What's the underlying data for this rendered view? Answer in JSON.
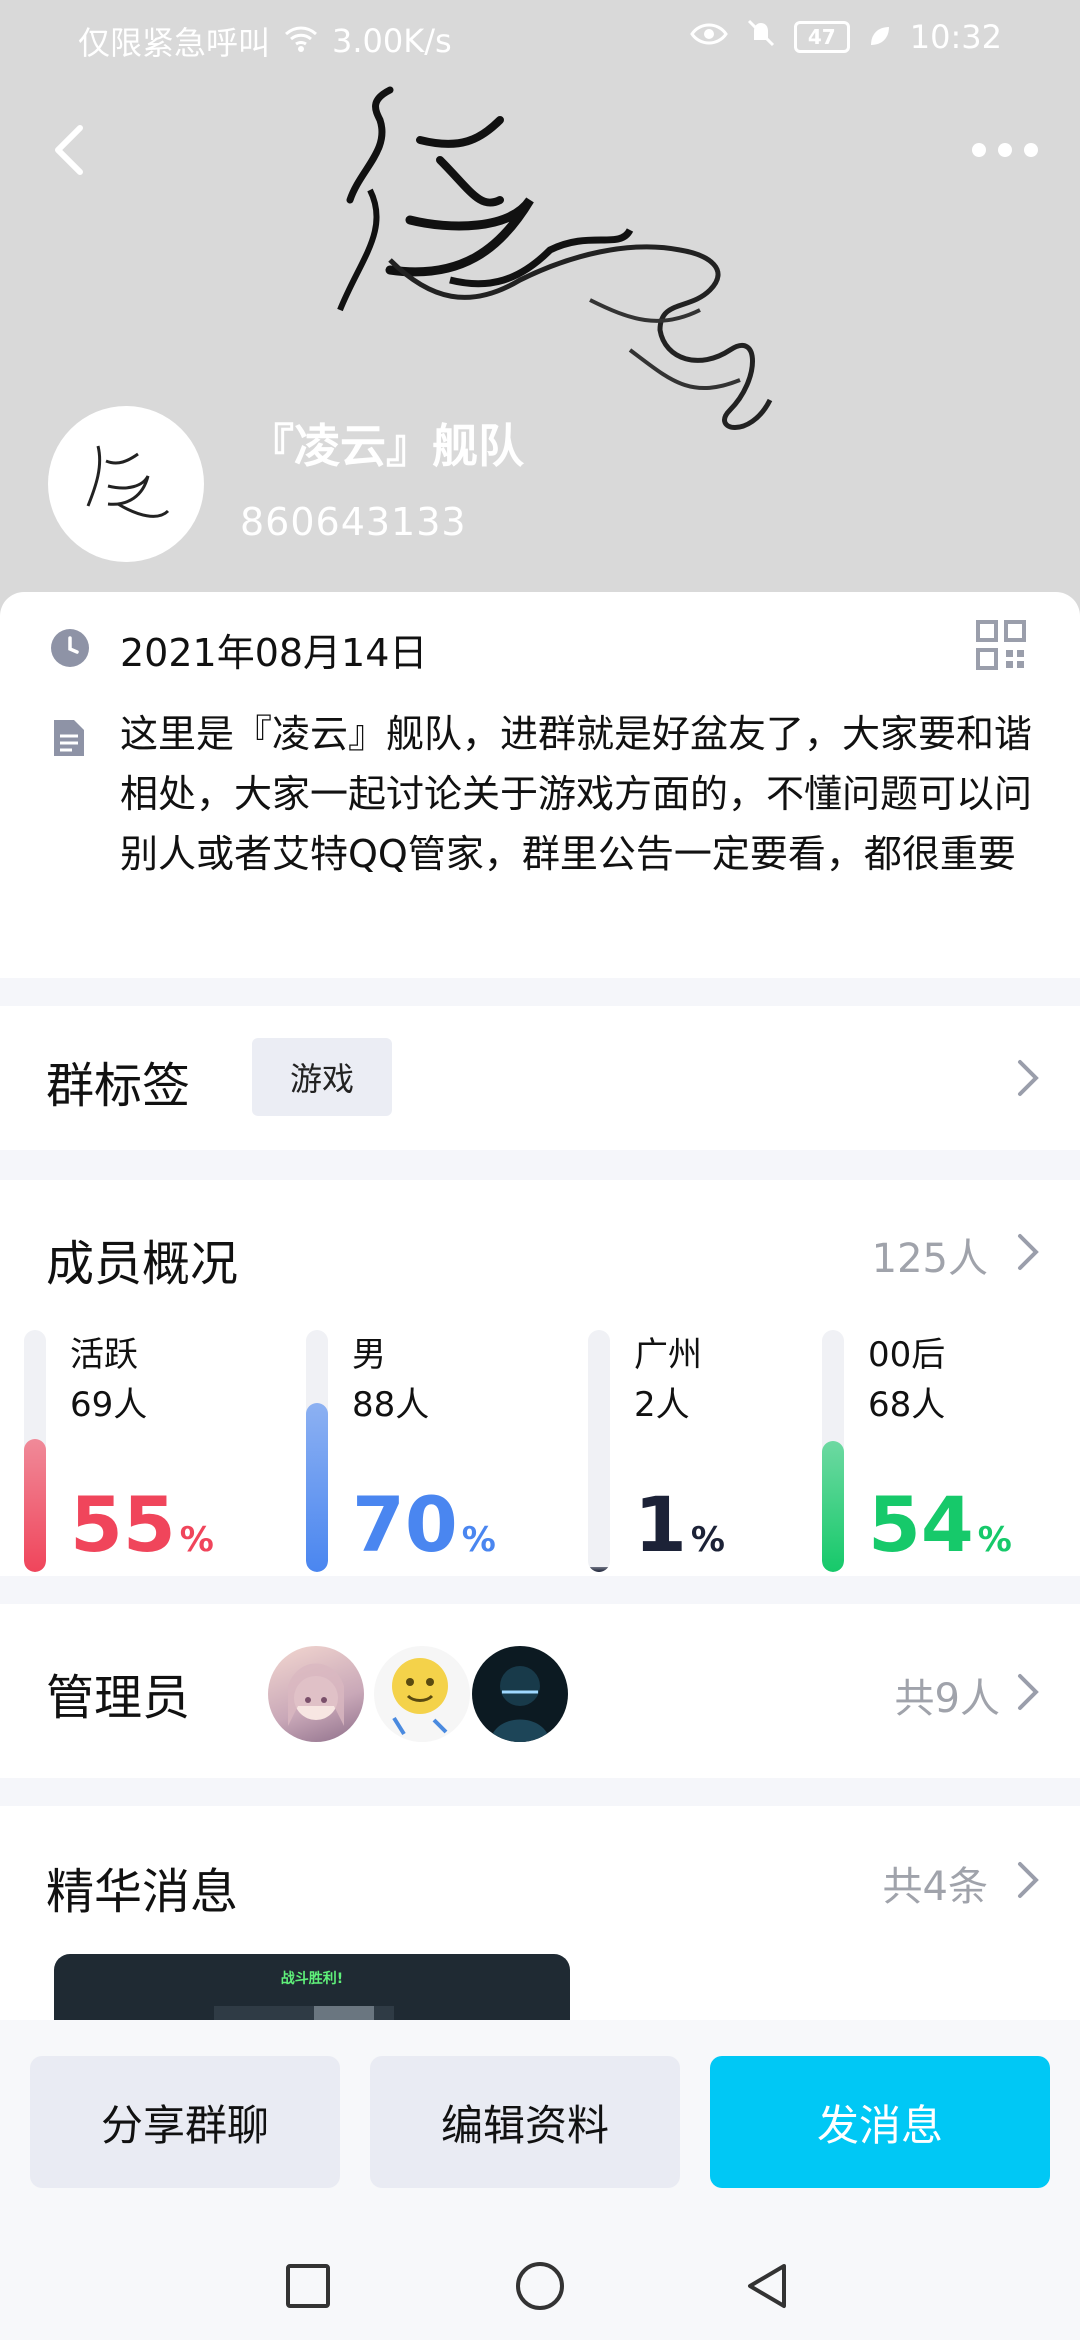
{
  "status_bar": {
    "carrier": "仅限紧急呼叫",
    "speed": "3.00K/s",
    "battery": "47",
    "time": "10:32"
  },
  "group": {
    "name": "『凌云』舰队",
    "id": "860643133"
  },
  "info": {
    "date": "2021年08月14日",
    "description": "这里是『凌云』舰队，进群就是好盆友了，大家要和谐相处，大家一起讨论关于游戏方面的，不懂问题可以问别人或者艾特QQ管家，群里公告一定要看，都很重要"
  },
  "tags": {
    "title": "群标签",
    "items": [
      "游戏"
    ]
  },
  "members": {
    "title": "成员概况",
    "count": "125人",
    "stats": [
      {
        "label": "活跃",
        "count": "69人",
        "percent": 55,
        "color": "#f0455b"
      },
      {
        "label": "男",
        "count": "88人",
        "percent": 70,
        "color": "#4a86f0"
      },
      {
        "label": "广州",
        "count": "2人",
        "percent": 1,
        "color": "#1c2237"
      },
      {
        "label": "00后",
        "count": "68人",
        "percent": 54,
        "color": "#16c96a"
      }
    ]
  },
  "admins": {
    "title": "管理员",
    "count": "共9人"
  },
  "essence": {
    "title": "精华消息",
    "count": "共4条",
    "thumb_text": "战斗胜利!"
  },
  "actions": {
    "share": "分享群聊",
    "edit": "编辑资料",
    "send": "发消息"
  }
}
